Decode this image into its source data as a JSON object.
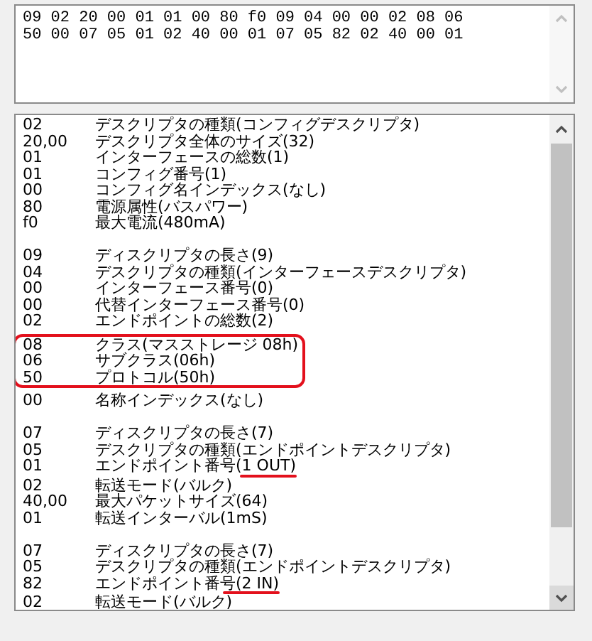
{
  "hex_dump": {
    "lines": [
      "09 02 20 00 01 01 00 80 f0 09 04 00 00 02 08 06",
      "50 00 07 05 01 02 40 00 01 07 05 82 02 40 00 01"
    ]
  },
  "descriptor_list": {
    "rows": [
      {
        "kind": "entry",
        "value": "02",
        "description": "デスクリプタの種類(コンフィグデスクリプタ)",
        "circled": false,
        "underlined": false
      },
      {
        "kind": "entry",
        "value": "20,00",
        "description": "デスクリプタ全体のサイズ(32)",
        "circled": false,
        "underlined": false
      },
      {
        "kind": "entry",
        "value": "01",
        "description": "インターフェースの総数(1)",
        "circled": false,
        "underlined": false
      },
      {
        "kind": "entry",
        "value": "01",
        "description": "コンフィグ番号(1)",
        "circled": false,
        "underlined": false
      },
      {
        "kind": "entry",
        "value": "00",
        "description": "コンフィグ名インデックス(なし)",
        "circled": false,
        "underlined": false
      },
      {
        "kind": "entry",
        "value": "80",
        "description": "電源属性(バスパワー)",
        "circled": false,
        "underlined": false
      },
      {
        "kind": "entry",
        "value": "f0",
        "description": "最大電流(480mA)",
        "circled": false,
        "underlined": false
      },
      {
        "kind": "spacer"
      },
      {
        "kind": "entry",
        "value": "09",
        "description": "ディスクリプタの長さ(9)",
        "circled": false,
        "underlined": false
      },
      {
        "kind": "entry",
        "value": "04",
        "description": "デスクリプタの種類(インターフェースデスクリプタ)",
        "circled": false,
        "underlined": false
      },
      {
        "kind": "entry",
        "value": "00",
        "description": "インターフェース番号(0)",
        "circled": false,
        "underlined": false
      },
      {
        "kind": "entry",
        "value": "00",
        "description": "代替インターフェース番号(0)",
        "circled": false,
        "underlined": false
      },
      {
        "kind": "entry",
        "value": "02",
        "description": "エンドポイントの総数(2)",
        "circled": false,
        "underlined": false
      },
      {
        "kind": "entry",
        "value": "08",
        "description": "クラス(マスストレージ 08h)",
        "circled": true,
        "underlined": false
      },
      {
        "kind": "entry",
        "value": "06",
        "description": "サブクラス(06h)",
        "circled": true,
        "underlined": false
      },
      {
        "kind": "entry",
        "value": "50",
        "description": "プロトコル(50h)",
        "circled": true,
        "underlined": false
      },
      {
        "kind": "entry",
        "value": "00",
        "description": "名称インデックス(なし)",
        "circled": false,
        "underlined": false
      },
      {
        "kind": "spacer"
      },
      {
        "kind": "entry",
        "value": "07",
        "description": "ディスクリプタの長さ(7)",
        "circled": false,
        "underlined": false
      },
      {
        "kind": "entry",
        "value": "05",
        "description": "デスクリプタの種類(エンドポイントデスクリプタ)",
        "circled": false,
        "underlined": false
      },
      {
        "kind": "entry",
        "value": "01",
        "description": "エンドポイント番号(1 OUT)",
        "circled": false,
        "underlined": true
      },
      {
        "kind": "entry",
        "value": "02",
        "description": "転送モード(バルク)",
        "circled": false,
        "underlined": false
      },
      {
        "kind": "entry",
        "value": "40,00",
        "description": "最大パケットサイズ(64)",
        "circled": false,
        "underlined": false
      },
      {
        "kind": "entry",
        "value": "01",
        "description": "転送インターバル(1mS)",
        "circled": false,
        "underlined": false
      },
      {
        "kind": "spacer"
      },
      {
        "kind": "entry",
        "value": "07",
        "description": "ディスクリプタの長さ(7)",
        "circled": false,
        "underlined": false
      },
      {
        "kind": "entry",
        "value": "05",
        "description": "デスクリプタの種類(エンドポイントデスクリプタ)",
        "circled": false,
        "underlined": false
      },
      {
        "kind": "entry",
        "value": "82",
        "description": "エンドポイント番号(2 IN)",
        "circled": false,
        "underlined": true
      },
      {
        "kind": "entry",
        "value": "02",
        "description": "転送モード(バルク)",
        "circled": false,
        "underlined": false
      }
    ]
  }
}
